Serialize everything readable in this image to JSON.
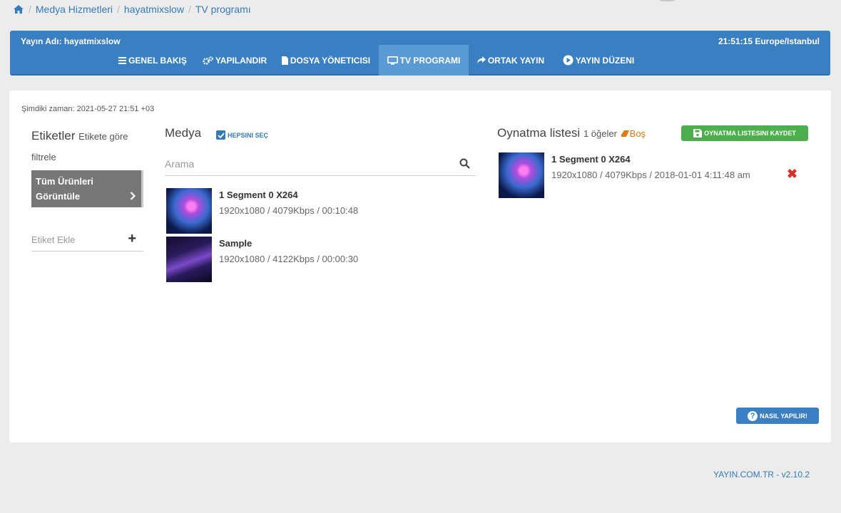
{
  "breadcrumb": {
    "home_icon": "home-icon",
    "items": [
      "Medya Hizmetleri",
      "hayatmixslow",
      "TV programı"
    ]
  },
  "header": {
    "title": "Yayın Adı: hayatmixslow",
    "clock": "21:51:15 Europe/Istanbul",
    "tabs": [
      {
        "label": "GENEL BAKIŞ",
        "icon": "list-icon"
      },
      {
        "label": "YAPILANDIR",
        "icon": "gears-icon"
      },
      {
        "label": "DOSYA YÖNETICISI",
        "icon": "file-icon"
      },
      {
        "label": "TV PROGRAMI",
        "icon": "monitor-icon",
        "active": true
      },
      {
        "label": "ORTAK YAYIN",
        "icon": "share-icon"
      },
      {
        "label": "YAYIN DÜZENI",
        "icon": "play-circle-icon"
      }
    ]
  },
  "now": "Şimdiki zaman: 2021-05-27 21:51 +03",
  "tags": {
    "title": "Etiketler",
    "subtitle": "Etikete göre filtrele",
    "all_label_line1": "Tüm Ürünleri",
    "all_label_line2": "Görüntüle",
    "add_placeholder": "Etiket Ekle"
  },
  "media": {
    "title": "Medya",
    "select_all": "HEPSINI SEÇ",
    "search_placeholder": "Arama",
    "items": [
      {
        "name": "1 Segment 0 X264",
        "info": "1920x1080 / 4079Kbps / 00:10:48"
      },
      {
        "name": "Sample",
        "info": "1920x1080 / 4122Kbps / 00:00:30"
      }
    ]
  },
  "playlist": {
    "title": "Oynatma listesi",
    "count": "1 öğeler",
    "empty": "Boş",
    "save_label": "OYNATMA LISTESINI KAYDET",
    "items": [
      {
        "name": "1 Segment 0 X264",
        "info": "1920x1080 / 4079Kbps / 2018-01-01 4:11:48 am"
      }
    ]
  },
  "help_label": "NASIL YAPILIR!",
  "help_icon": "?",
  "remove_icon": "✖",
  "footer": "YAYIN.COM.TR - v2.10.2",
  "colors": {
    "primary": "#3a7fc1",
    "active_tab": "#5b9bd5",
    "success": "#4cae4c",
    "danger": "#d9302c",
    "warning": "#e07a10"
  }
}
